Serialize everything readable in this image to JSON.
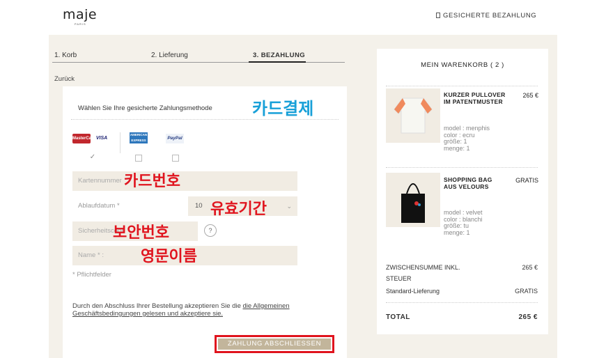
{
  "header": {
    "logo": "maje",
    "logo_sub": "PARIS",
    "secure_payment": "GESICHERTE BEZAHLUNG"
  },
  "steps": [
    {
      "label": "1. Korb"
    },
    {
      "label": "2. Lieferung"
    },
    {
      "label": "3. BEZAHLUNG"
    }
  ],
  "back_link": "Zurück",
  "payment": {
    "choose_method": "Wählen Sie Ihre gesicherte Zahlungsmethode",
    "methods": [
      {
        "name": "mastercard-visa",
        "mc": "MasterCard",
        "visa": "VISA",
        "checked": true
      },
      {
        "name": "amex",
        "label": "AMERICAN EXPRESS",
        "checked": false
      },
      {
        "name": "paypal",
        "label": "PayPal",
        "checked": false
      }
    ],
    "card_number_placeholder": "Kartennummer",
    "expiry_label": "Ablaufdatum *",
    "expiry_month": "10",
    "security_code_placeholder": "Sicherheitscode",
    "help_icon": "?",
    "name_placeholder": "Name * :",
    "required_note": "* Pflichtfelder",
    "agb_text": "Durch den Abschluss Ihrer Bestellung akzeptieren Sie die ",
    "agb_link": "die Allgemeinen Geschäftsbedingungen gelesen und akzeptiere sie.",
    "submit_label": "ZAHLUNG ABSCHLIESSEN"
  },
  "annotations": {
    "card_payment": "카드결제",
    "card_number": "카드번호",
    "expiry": "유효기간",
    "security_code": "보안번호",
    "english_name": "영문이름"
  },
  "cart": {
    "title": "MEIN WARENKORB ( 2 )",
    "items": [
      {
        "name": "KURZER PULLOVER IM PATENTMUSTER",
        "price": "265 €",
        "meta": [
          "model : menphis",
          "color : ecru",
          "größe: 1",
          "menge: 1"
        ]
      },
      {
        "name": "SHOPPING BAG AUS VELOURS",
        "price": "GRATIS",
        "meta": [
          "model : velvet",
          "color : blanchi",
          "größe: tu",
          "menge: 1"
        ]
      }
    ],
    "subtotal_label": "ZWISCHENSUMME INKL. STEUER",
    "subtotal_label_1": "ZWISCHENSUMME INKL.",
    "subtotal_label_2": "STEUER",
    "subtotal_value": "265 €",
    "shipping_label": "Standard-Lieferung",
    "shipping_value": "GRATIS",
    "total_label": "TOTAL",
    "total_value": "265 €"
  },
  "colors": {
    "accent_button": "#c2b59b",
    "highlight_border": "#e0141e",
    "annotation_blue": "#18a0d8",
    "annotation_red": "#e0141e",
    "background": "#f4f1ea"
  }
}
